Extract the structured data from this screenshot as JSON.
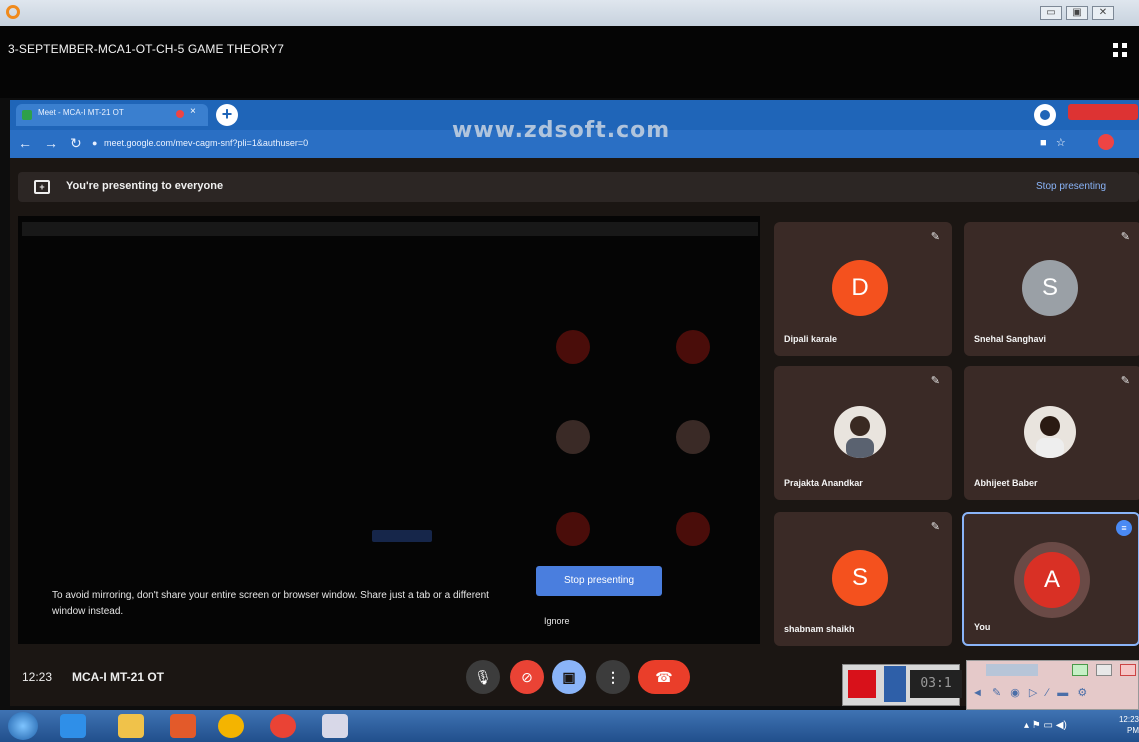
{
  "player": {
    "title": "3-SEPTEMBER-MCA1-OT-CH-5 GAME THEORY7",
    "window_controls": [
      "▭",
      "▣",
      "✕"
    ]
  },
  "chrome": {
    "tab_label": "Meet - MCA-I MT-21 OT",
    "tab_close": "×",
    "new_tab": "+",
    "address": "meet.google.com/mev-cagm-snf?pli=1&authuser=0",
    "watermark": "www.zdsoft.com"
  },
  "meet": {
    "banner_text": "You're presenting to everyone",
    "banner_stop": "Stop presenting",
    "mirror_warning": "To avoid mirroring, don't share your entire screen or browser window. Share just a tab or a different window instead.",
    "stop_button": "Stop presenting",
    "ignore_button": "Ignore",
    "time": "12:23",
    "meeting_code": "MCA-I MT-21 OT"
  },
  "participants": [
    {
      "name": "Dipali karale",
      "initial": "D",
      "color": "#f4511e"
    },
    {
      "name": "Snehal Sanghavi",
      "initial": "S",
      "color": "#9aa0a6"
    },
    {
      "name": "Prajakta Anandkar",
      "initial": "",
      "color": ""
    },
    {
      "name": "Abhijeet Baber",
      "initial": "",
      "color": ""
    },
    {
      "name": "shabnam shaikh",
      "initial": "S",
      "color": "#f4511e"
    },
    {
      "name": "You",
      "initial": "A",
      "color": "#d93025"
    }
  ],
  "recorder": {
    "counter": "03:1"
  },
  "taskbar": {
    "clock_time": "12:23 PM"
  }
}
